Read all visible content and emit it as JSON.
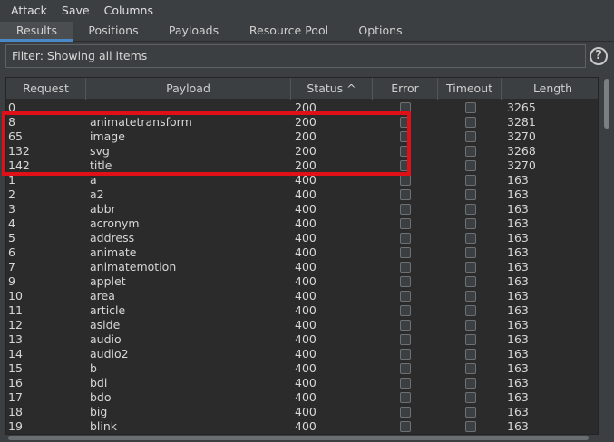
{
  "menu": [
    "Attack",
    "Save",
    "Columns"
  ],
  "tabs": [
    "Results",
    "Positions",
    "Payloads",
    "Resource Pool",
    "Options"
  ],
  "active_tab": "Results",
  "filter": {
    "text": "Filter: Showing all items"
  },
  "help": {
    "label": "?"
  },
  "columns": {
    "request": "Request",
    "payload": "Payload",
    "status": "Status ^",
    "error": "Error",
    "timeout": "Timeout",
    "length": "Length"
  },
  "rows": [
    {
      "request": "0",
      "payload": "",
      "status": "200",
      "length": "3265"
    },
    {
      "request": "8",
      "payload": "animatetransform",
      "status": "200",
      "length": "3281"
    },
    {
      "request": "65",
      "payload": "image",
      "status": "200",
      "length": "3270"
    },
    {
      "request": "132",
      "payload": "svg",
      "status": "200",
      "length": "3268"
    },
    {
      "request": "142",
      "payload": "title",
      "status": "200",
      "length": "3270"
    },
    {
      "request": "1",
      "payload": "a",
      "status": "400",
      "length": "163"
    },
    {
      "request": "2",
      "payload": "a2",
      "status": "400",
      "length": "163"
    },
    {
      "request": "3",
      "payload": "abbr",
      "status": "400",
      "length": "163"
    },
    {
      "request": "4",
      "payload": "acronym",
      "status": "400",
      "length": "163"
    },
    {
      "request": "5",
      "payload": "address",
      "status": "400",
      "length": "163"
    },
    {
      "request": "6",
      "payload": "animate",
      "status": "400",
      "length": "163"
    },
    {
      "request": "7",
      "payload": "animatemotion",
      "status": "400",
      "length": "163"
    },
    {
      "request": "9",
      "payload": "applet",
      "status": "400",
      "length": "163"
    },
    {
      "request": "10",
      "payload": "area",
      "status": "400",
      "length": "163"
    },
    {
      "request": "11",
      "payload": "article",
      "status": "400",
      "length": "163"
    },
    {
      "request": "12",
      "payload": "aside",
      "status": "400",
      "length": "163"
    },
    {
      "request": "13",
      "payload": "audio",
      "status": "400",
      "length": "163"
    },
    {
      "request": "14",
      "payload": "audio2",
      "status": "400",
      "length": "163"
    },
    {
      "request": "15",
      "payload": "b",
      "status": "400",
      "length": "163"
    },
    {
      "request": "16",
      "payload": "bdi",
      "status": "400",
      "length": "163"
    },
    {
      "request": "17",
      "payload": "bdo",
      "status": "400",
      "length": "163"
    },
    {
      "request": "18",
      "payload": "big",
      "status": "400",
      "length": "163"
    },
    {
      "request": "19",
      "payload": "blink",
      "status": "400",
      "length": "163"
    }
  ],
  "colors": {
    "background": "#3c3f41",
    "table_background": "#2b2b2b",
    "highlight": "#e01018",
    "active_tab_underline": "#4a88c7"
  }
}
